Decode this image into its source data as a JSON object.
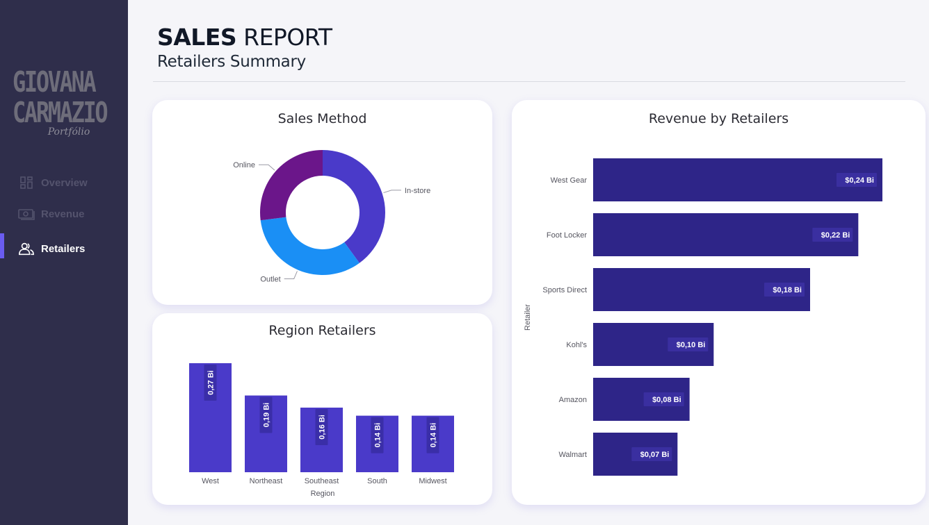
{
  "sidebar": {
    "logo_line1": "GIOVANA",
    "logo_line2": "CARMAZIO",
    "logo_sub": "Portfólio",
    "items": [
      {
        "label": "Overview",
        "icon": "dashboard-icon",
        "active": false
      },
      {
        "label": "Revenue",
        "icon": "money-icon",
        "active": false
      },
      {
        "label": "Retailers",
        "icon": "users-icon",
        "active": true
      }
    ]
  },
  "header": {
    "title_bold": "SALES",
    "title_rest": "REPORT",
    "subtitle": "Retailers Summary"
  },
  "cards": {
    "sales_method": {
      "title": "Sales Method"
    },
    "region": {
      "title": "Region Retailers"
    },
    "revenue": {
      "title": "Revenue by Retailers"
    }
  },
  "colors": {
    "sidebar_bg": "#2f2e4b",
    "accent": "#6a5cf0",
    "bar_region": "#4a3ac9",
    "bar_retailer": "#2e2588",
    "donut_instore": "#4a3ac9",
    "donut_outlet": "#1a8ff5",
    "donut_online": "#6b168a"
  },
  "chart_data": [
    {
      "type": "pie",
      "title": "Sales Method",
      "categories": [
        "In-store",
        "Outlet",
        "Online"
      ],
      "values": [
        40,
        33,
        27
      ],
      "legend": "data labels"
    },
    {
      "type": "bar",
      "title": "Region Retailers",
      "categories": [
        "West",
        "Northeast",
        "Southeast",
        "South",
        "Midwest"
      ],
      "values": [
        0.27,
        0.19,
        0.16,
        0.14,
        0.14
      ],
      "data_labels": [
        "0,27 Bi",
        "0,19 Bi",
        "0,16 Bi",
        "0,14 Bi",
        "0,14 Bi"
      ],
      "xlabel": "Region",
      "ylabel": "",
      "ylim": [
        0,
        0.27
      ]
    },
    {
      "type": "bar",
      "orientation": "horizontal",
      "title": "Revenue by Retailers",
      "categories": [
        "West Gear",
        "Foot Locker",
        "Sports Direct",
        "Kohl's",
        "Amazon",
        "Walmart"
      ],
      "values": [
        0.24,
        0.22,
        0.18,
        0.1,
        0.08,
        0.07
      ],
      "data_labels": [
        "$0,24 Bi",
        "$0,22 Bi",
        "$0,18 Bi",
        "$0,10 Bi",
        "$0,08 Bi",
        "$0,07 Bi"
      ],
      "xlabel": "",
      "ylabel": "Retailer",
      "xlim": [
        0,
        0.24
      ]
    }
  ]
}
